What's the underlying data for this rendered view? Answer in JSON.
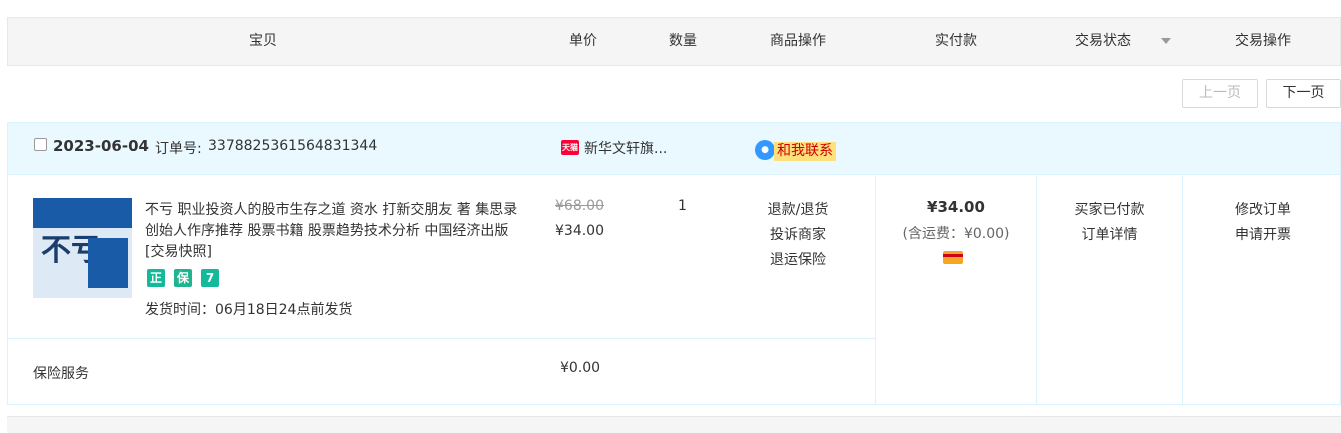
{
  "header": {
    "item": "宝贝",
    "unit_price": "单价",
    "quantity": "数量",
    "item_ops": "商品操作",
    "paid": "实付款",
    "trade_status": "交易状态",
    "trade_ops": "交易操作"
  },
  "pager": {
    "prev": "上一页",
    "next": "下一页"
  },
  "order": {
    "date": "2023-06-04",
    "order_id_label": "订单号:",
    "order_id": "3378825361564831344",
    "shop_badge": "天猫",
    "shop_name": "新华文轩旗...",
    "contact_label": "和我联系",
    "item": {
      "title": "不亏 职业投资人的股市生存之道 资水 打新交朋友 著 集思录创始人作序推荐 股票书籍 股票趋势技术分析 中国经济出版 [交易快照]",
      "cover_text": "不亏",
      "badges": [
        "正",
        "保",
        "7"
      ],
      "ship_time": "发货时间：06月18日24点前发货",
      "price_original": "¥68.00",
      "price": "¥34.00",
      "quantity": "1",
      "ops": [
        "退款/退货",
        "投诉商家",
        "退运保险"
      ]
    },
    "paid_amount": "¥34.00",
    "shipping_fee": "(含运费：¥0.00)",
    "status": [
      "买家已付款",
      "订单详情"
    ],
    "actions": [
      "修改订单",
      "申请开票"
    ],
    "insurance": {
      "label": "保险服务",
      "price": "¥0.00"
    }
  },
  "colors": {
    "order_header_bg": "#eaf8ff",
    "tmall_red": "#ff0036",
    "badge_green": "#14b99a",
    "badge_green2": "#1fb58e",
    "contact_bg": "#ffe07a"
  }
}
